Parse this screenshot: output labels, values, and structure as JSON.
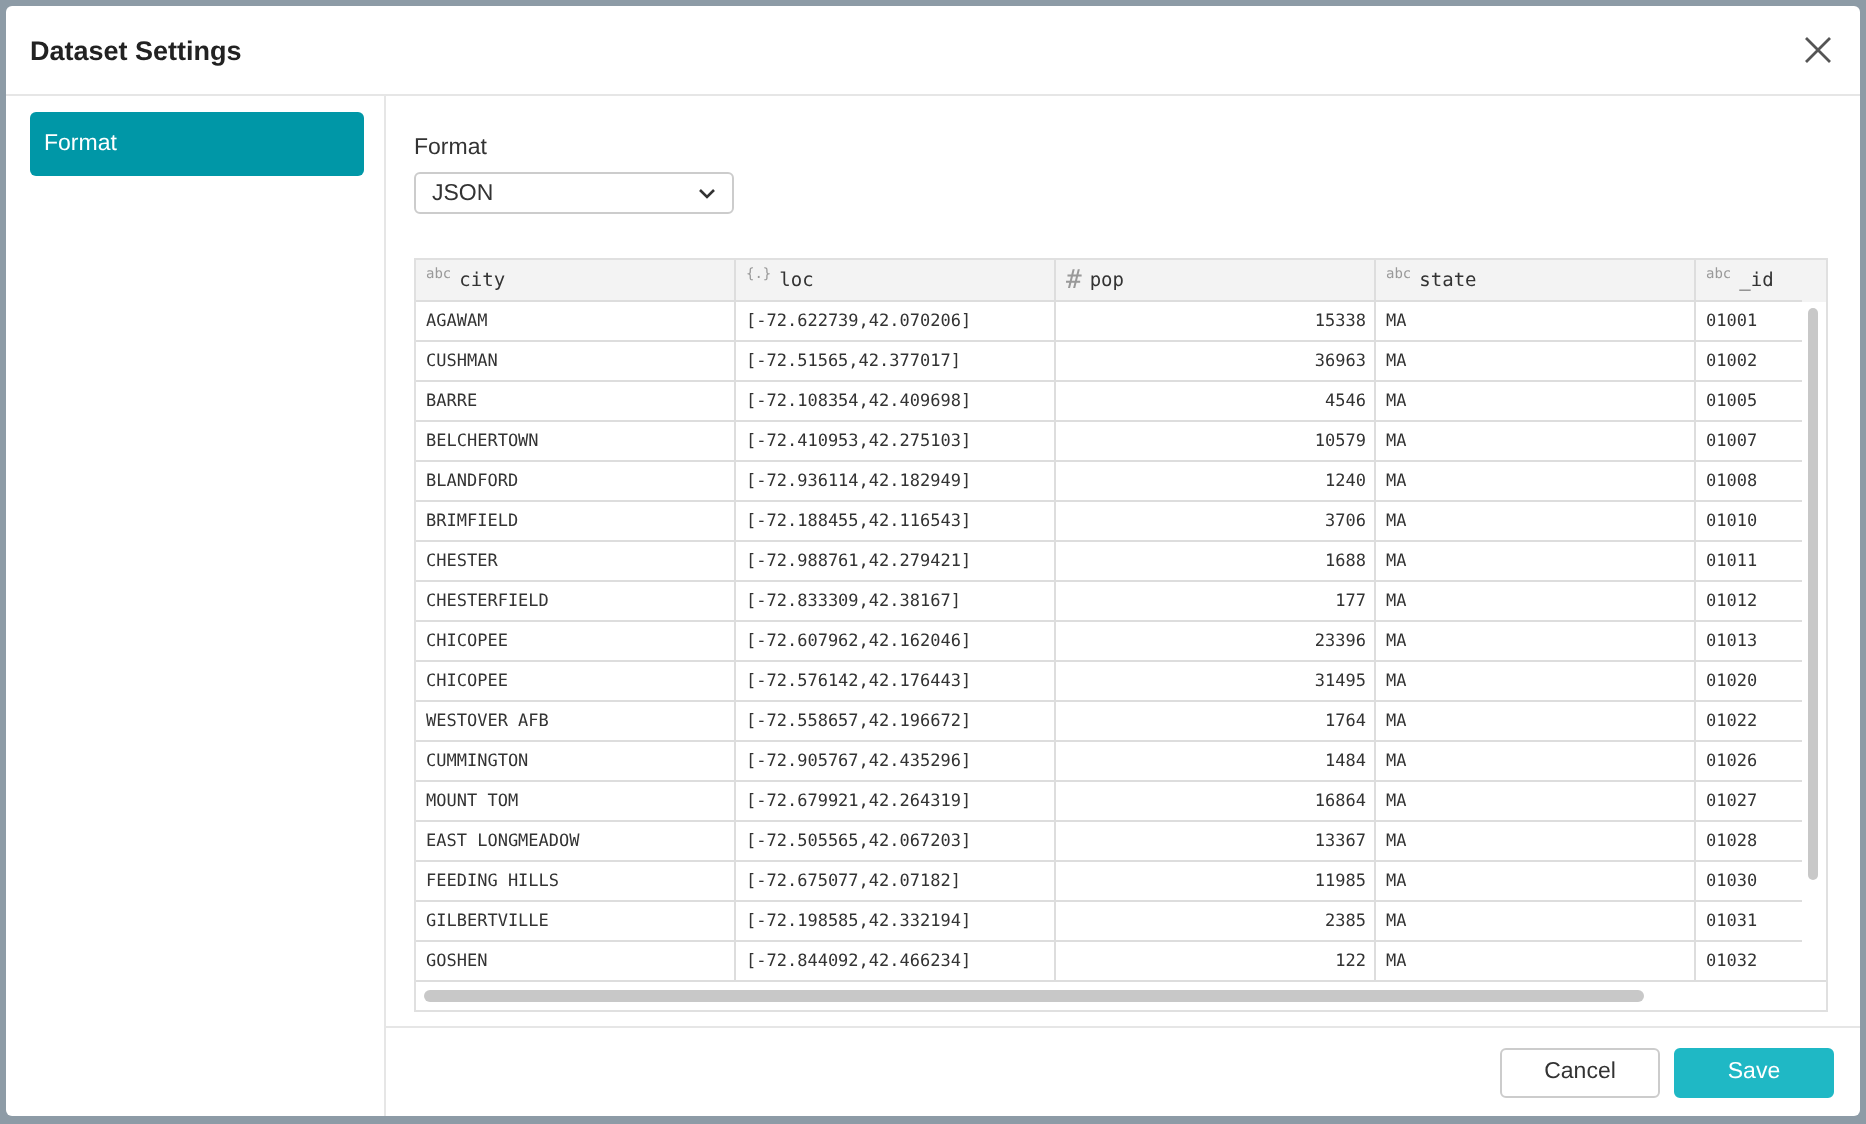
{
  "dialog": {
    "title": "Dataset Settings"
  },
  "sidebar": {
    "items": [
      {
        "label": "Format",
        "selected": true
      }
    ]
  },
  "format_field": {
    "label": "Format",
    "value": "JSON"
  },
  "table": {
    "columns": [
      {
        "type_glyph": "abc",
        "name": "city",
        "kind": "text"
      },
      {
        "type_glyph": "{.}",
        "name": "loc",
        "kind": "text"
      },
      {
        "type_glyph": "#",
        "name": "pop",
        "kind": "number"
      },
      {
        "type_glyph": "abc",
        "name": "state",
        "kind": "text"
      },
      {
        "type_glyph": "abc",
        "name": "_id",
        "kind": "text"
      }
    ],
    "rows": [
      [
        "AGAWAM",
        "[-72.622739,42.070206]",
        "15338",
        "MA",
        "01001"
      ],
      [
        "CUSHMAN",
        "[-72.51565,42.377017]",
        "36963",
        "MA",
        "01002"
      ],
      [
        "BARRE",
        "[-72.108354,42.409698]",
        "4546",
        "MA",
        "01005"
      ],
      [
        "BELCHERTOWN",
        "[-72.410953,42.275103]",
        "10579",
        "MA",
        "01007"
      ],
      [
        "BLANDFORD",
        "[-72.936114,42.182949]",
        "1240",
        "MA",
        "01008"
      ],
      [
        "BRIMFIELD",
        "[-72.188455,42.116543]",
        "3706",
        "MA",
        "01010"
      ],
      [
        "CHESTER",
        "[-72.988761,42.279421]",
        "1688",
        "MA",
        "01011"
      ],
      [
        "CHESTERFIELD",
        "[-72.833309,42.38167]",
        "177",
        "MA",
        "01012"
      ],
      [
        "CHICOPEE",
        "[-72.607962,42.162046]",
        "23396",
        "MA",
        "01013"
      ],
      [
        "CHICOPEE",
        "[-72.576142,42.176443]",
        "31495",
        "MA",
        "01020"
      ],
      [
        "WESTOVER AFB",
        "[-72.558657,42.196672]",
        "1764",
        "MA",
        "01022"
      ],
      [
        "CUMMINGTON",
        "[-72.905767,42.435296]",
        "1484",
        "MA",
        "01026"
      ],
      [
        "MOUNT TOM",
        "[-72.679921,42.264319]",
        "16864",
        "MA",
        "01027"
      ],
      [
        "EAST LONGMEADOW",
        "[-72.505565,42.067203]",
        "13367",
        "MA",
        "01028"
      ],
      [
        "FEEDING HILLS",
        "[-72.675077,42.07182]",
        "11985",
        "MA",
        "01030"
      ],
      [
        "GILBERTVILLE",
        "[-72.198585,42.332194]",
        "2385",
        "MA",
        "01031"
      ],
      [
        "GOSHEN",
        "[-72.844092,42.466234]",
        "122",
        "MA",
        "01032"
      ]
    ]
  },
  "buttons": [
    {
      "label": "Cancel",
      "kind": "secondary"
    },
    {
      "label": "Save",
      "kind": "primary"
    }
  ]
}
